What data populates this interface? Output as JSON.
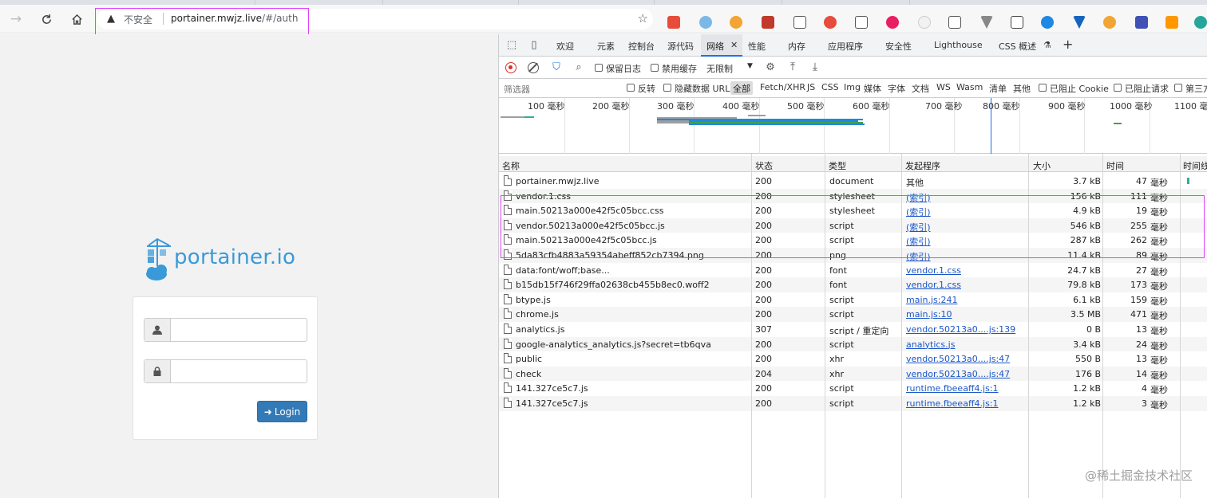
{
  "browser": {
    "insecure_label": "不安全",
    "host": "portainer.mwjz.live",
    "path": "/#/auth"
  },
  "portainer": {
    "logo_text": "portainer.io",
    "username_placeholder": "",
    "password_placeholder": "",
    "login_label": "Login"
  },
  "devtools": {
    "tabs": [
      "欢迎",
      "元素",
      "控制台",
      "源代码",
      "网络",
      "性能",
      "内存",
      "应用程序",
      "安全性",
      "Lighthouse",
      "CSS 概述"
    ],
    "active_tab": "网络",
    "bar2": {
      "preserve_log": "保留日志",
      "disable_cache": "禁用缓存",
      "throttle": "无限制"
    },
    "bar3": {
      "filter_placeholder": "筛选器",
      "invert": "反转",
      "hide_data_urls": "隐藏数据 URL",
      "all": "全部",
      "types": [
        "Fetch/XHR",
        "JS",
        "CSS",
        "Img",
        "媒体",
        "字体",
        "文档",
        "WS",
        "Wasm",
        "清单",
        "其他"
      ],
      "blocked_cookies": "已阻止 Cookie",
      "blocked_requests": "已阻止请求",
      "third_party": "第三方"
    },
    "overview_ticks": [
      "100 毫秒",
      "200 毫秒",
      "300 毫秒",
      "400 毫秒",
      "500 毫秒",
      "600 毫秒",
      "700 毫秒",
      "800 毫秒",
      "900 毫秒",
      "1000 毫秒",
      "1100 毫秒"
    ],
    "columns": {
      "name": "名称",
      "status": "状态",
      "type": "类型",
      "initiator": "发起程序",
      "size": "大小",
      "time": "时间",
      "waterfall": "时间线"
    },
    "rows": [
      {
        "name": "portainer.mwjz.live",
        "status": "200",
        "type": "document",
        "initiator": "其他",
        "size": "3.7 kB",
        "time": "47",
        "unit": "毫秒"
      },
      {
        "name": "vendor.1.css",
        "status": "200",
        "type": "stylesheet",
        "initiator": "(索引)",
        "size": "156 kB",
        "time": "111",
        "unit": "毫秒"
      },
      {
        "name": "main.50213a000e42f5c05bcc.css",
        "status": "200",
        "type": "stylesheet",
        "initiator": "(索引)",
        "size": "4.9 kB",
        "time": "19",
        "unit": "毫秒"
      },
      {
        "name": "vendor.50213a000e42f5c05bcc.js",
        "status": "200",
        "type": "script",
        "initiator": "(索引)",
        "size": "546 kB",
        "time": "255",
        "unit": "毫秒"
      },
      {
        "name": "main.50213a000e42f5c05bcc.js",
        "status": "200",
        "type": "script",
        "initiator": "(索引)",
        "size": "287 kB",
        "time": "262",
        "unit": "毫秒"
      },
      {
        "name": "5da83cfb4883a59354abeff852cb7394.png",
        "status": "200",
        "type": "png",
        "initiator": "(索引)",
        "size": "11.4 kB",
        "time": "89",
        "unit": "毫秒"
      },
      {
        "name": "data:font/woff;base...",
        "status": "200",
        "type": "font",
        "initiator": "vendor.1.css",
        "size": "24.7 kB",
        "time": "27",
        "unit": "毫秒"
      },
      {
        "name": "b15db15f746f29ffa02638cb455b8ec0.woff2",
        "status": "200",
        "type": "font",
        "initiator": "vendor.1.css",
        "size": "79.8 kB",
        "time": "173",
        "unit": "毫秒"
      },
      {
        "name": "btype.js",
        "status": "200",
        "type": "script",
        "initiator": "main.js:241",
        "size": "6.1 kB",
        "time": "159",
        "unit": "毫秒"
      },
      {
        "name": "chrome.js",
        "status": "200",
        "type": "script",
        "initiator": "main.js:10",
        "size": "3.5 MB",
        "time": "471",
        "unit": "毫秒"
      },
      {
        "name": "analytics.js",
        "status": "307",
        "type": "script / 重定向",
        "initiator": "vendor.50213a0....js:139",
        "size": "0 B",
        "time": "13",
        "unit": "毫秒"
      },
      {
        "name": "google-analytics_analytics.js?secret=tb6qva",
        "status": "200",
        "type": "script",
        "initiator": "analytics.js",
        "size": "3.4 kB",
        "time": "24",
        "unit": "毫秒"
      },
      {
        "name": "public",
        "status": "200",
        "type": "xhr",
        "initiator": "vendor.50213a0....js:47",
        "size": "550 B",
        "time": "13",
        "unit": "毫秒"
      },
      {
        "name": "check",
        "status": "204",
        "type": "xhr",
        "initiator": "vendor.50213a0....js:47",
        "size": "176 B",
        "time": "14",
        "unit": "毫秒"
      },
      {
        "name": "141.327ce5c7.js",
        "status": "200",
        "type": "script",
        "initiator": "runtime.fbeeaff4.js:1",
        "size": "1.2 kB",
        "time": "4",
        "unit": "毫秒"
      },
      {
        "name": "141.327ce5c7.js",
        "status": "200",
        "type": "script",
        "initiator": "runtime.fbeeaff4.js:1",
        "size": "1.2 kB",
        "time": "3",
        "unit": "毫秒"
      }
    ]
  },
  "watermark": "@稀土掘金技术社区"
}
